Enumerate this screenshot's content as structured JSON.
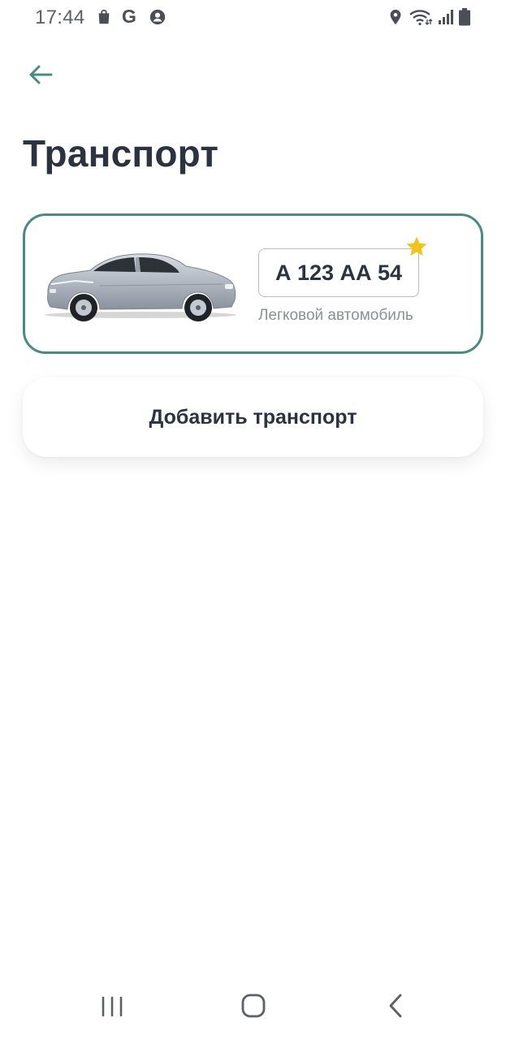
{
  "status_bar": {
    "time": "17:44",
    "g_label": "G",
    "icons": [
      "shopping-bag-icon",
      "google-icon",
      "account-icon",
      "location-icon",
      "wifi-icon",
      "signal-icon",
      "battery-icon"
    ]
  },
  "header": {
    "back_icon": "arrow-left-icon",
    "title": "Транспорт"
  },
  "vehicle": {
    "plate": "А 123 АА 54",
    "type": "Легковой автомобиль",
    "favorite_icon": "star-icon",
    "image": "sedan-car-image"
  },
  "actions": {
    "add_label": "Добавить транспорт"
  },
  "nav_bar": {
    "icons": [
      "recents-icon",
      "home-icon",
      "back-icon"
    ]
  },
  "colors": {
    "accent": "#4a8b80",
    "title": "#2b3340",
    "muted": "#8a9097",
    "star": "#f0c419"
  }
}
